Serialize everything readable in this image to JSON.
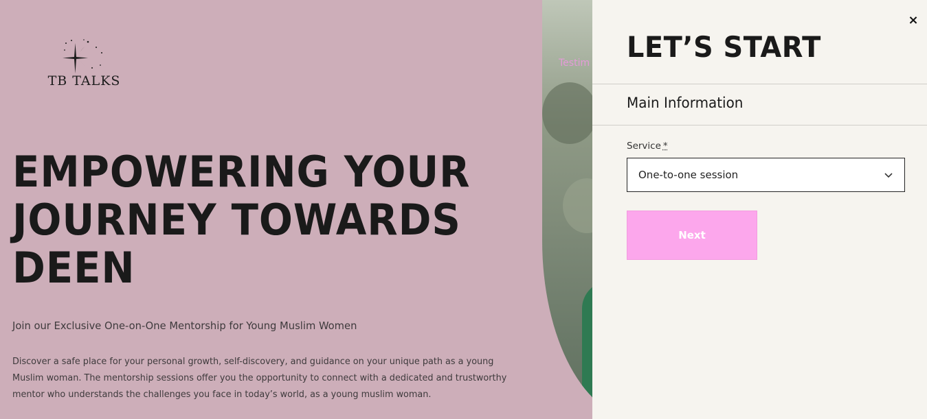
{
  "brand": {
    "name": "TB TALKS"
  },
  "nav": {
    "partial_link": "Testim"
  },
  "hero": {
    "headline_lines": [
      "EMPOWERING YOUR",
      "JOURNEY TOWARDS",
      "DEEN"
    ],
    "subtitle": "Join our Exclusive One-on-One Mentorship for Young Muslim Women",
    "body": "Discover a safe place for your personal growth, self-discovery, and guidance on your unique path as a young Muslim woman. The mentorship sessions offer you the opportunity to connect with a dedicated and trustworthy mentor who understands the challenges you face in today’s world, as a young muslim woman."
  },
  "panel": {
    "close_symbol": "×",
    "title": "LET’S START",
    "section": "Main Information",
    "service_label": "Service",
    "required_mark": "*",
    "service_value": "One-to-one session",
    "next_label": "Next"
  },
  "colors": {
    "hero_bg": "#cdaeb9",
    "panel_bg": "#f6f4ef",
    "accent": "#fca7ec",
    "nav_link": "#e59ad9"
  }
}
